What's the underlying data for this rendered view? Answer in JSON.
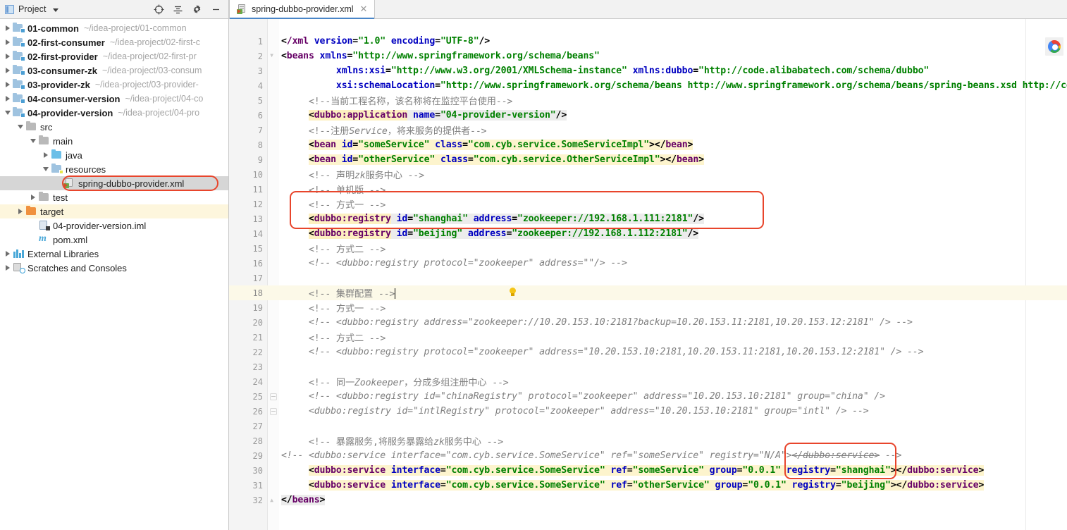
{
  "window": {
    "project_panel_title": "Project",
    "toolbar_icons": [
      "locate-icon",
      "collapse-all-icon",
      "settings-gear-icon",
      "minimize-icon"
    ]
  },
  "tab": {
    "label": "spring-dubbo-provider.xml",
    "close": "✕",
    "icon": "xml-file-icon"
  },
  "sidebar": {
    "items": [
      {
        "label": "01-common",
        "path": "~/idea-project/01-common",
        "indent": 0,
        "icon": "module-icon",
        "state": "collapsed"
      },
      {
        "label": "02-first-consumer",
        "path": "~/idea-project/02-first-c",
        "indent": 0,
        "icon": "module-icon",
        "state": "collapsed"
      },
      {
        "label": "02-first-provider",
        "path": "~/idea-project/02-first-pr",
        "indent": 0,
        "icon": "module-icon",
        "state": "collapsed"
      },
      {
        "label": "03-consumer-zk",
        "path": "~/idea-project/03-consum",
        "indent": 0,
        "icon": "module-icon",
        "state": "collapsed"
      },
      {
        "label": "03-provider-zk",
        "path": "~/idea-project/03-provider-",
        "indent": 0,
        "icon": "module-icon",
        "state": "collapsed"
      },
      {
        "label": "04-consumer-version",
        "path": "~/idea-project/04-co",
        "indent": 0,
        "icon": "module-icon",
        "state": "collapsed"
      },
      {
        "label": "04-provider-version",
        "path": "~/idea-project/04-pro",
        "indent": 0,
        "icon": "module-icon",
        "state": "expanded"
      },
      {
        "label": "src",
        "path": "",
        "indent": 1,
        "icon": "folder-icon",
        "state": "expanded",
        "plain": true
      },
      {
        "label": "main",
        "path": "",
        "indent": 2,
        "icon": "folder-icon",
        "state": "expanded",
        "plain": true
      },
      {
        "label": "java",
        "path": "",
        "indent": 3,
        "icon": "source-folder-icon",
        "state": "collapsed",
        "plain": true
      },
      {
        "label": "resources",
        "path": "",
        "indent": 3,
        "icon": "resources-folder-icon",
        "state": "expanded",
        "plain": true
      },
      {
        "label": "spring-dubbo-provider.xml",
        "path": "",
        "indent": 4,
        "icon": "xml-file-icon",
        "state": "none",
        "plain": true,
        "selected": true,
        "boxed": true
      },
      {
        "label": "test",
        "path": "",
        "indent": 2,
        "icon": "folder-icon",
        "state": "collapsed",
        "plain": true
      },
      {
        "label": "target",
        "path": "",
        "indent": 1,
        "icon": "target-folder-icon",
        "state": "collapsed",
        "plain": true,
        "highlight": true
      },
      {
        "label": "04-provider-version.iml",
        "path": "",
        "indent": 2,
        "icon": "iml-file-icon",
        "state": "none",
        "plain": true
      },
      {
        "label": "pom.xml",
        "path": "",
        "indent": 2,
        "icon": "maven-pom-icon",
        "state": "none",
        "plain": true
      },
      {
        "label": "External Libraries",
        "path": "",
        "indent": 0,
        "icon": "library-icon",
        "state": "collapsed",
        "plain": true
      },
      {
        "label": "Scratches and Consoles",
        "path": "",
        "indent": 0,
        "icon": "scratches-icon",
        "state": "collapsed",
        "plain": true
      }
    ]
  },
  "editor": {
    "current_line": 18,
    "total_lines": 32,
    "browser_icon": "chrome-icon",
    "bulb_icon": "intention-bulb-icon",
    "code": [
      {
        "n": 1,
        "html": "<span class='punct'>&lt;</span><span class='tagn'>/xml</span> <span class='attr'>version</span><span class='punct'>=</span><span class='val'>\"1.0\"</span> <span class='attr'>encoding</span><span class='punct'>=</span><span class='val'>\"UTF-8\"</span><span class='punct'>/&gt;</span>"
      },
      {
        "n": 2,
        "html": "<span class='punct'>&lt;</span><span class='tagn'>beans</span> <span class='attr'>xmlns</span><span class='punct'>=</span><span class='val'>\"http://www.springframework.org/schema/beans\"</span>"
      },
      {
        "n": 3,
        "html": "          <span class='attr'>xmlns:xsi</span><span class='punct'>=</span><span class='val'>\"http://www.w3.org/2001/XMLSchema-instance\"</span> <span class='attr'>xmlns:dubbo</span><span class='punct'>=</span><span class='val'>\"http://code.alibabatech.com/schema/dubbo\"</span>"
      },
      {
        "n": 4,
        "html": "          <span class='attr'>xsi:schemaLocation</span><span class='punct'>=</span><span class='val'>\"http://www.springframework.org/schema/beans http://www.springframework.org/schema/beans/spring-beans.xsd http://co</span>"
      },
      {
        "n": 5,
        "html": "     <span class='cmtz'>&lt;!--当前工程名称，该名称将在监控平台使用--&gt;</span>"
      },
      {
        "n": 6,
        "html": "     <span class='hl-tag punct'>&lt;</span><span class='hl-tag tagn'>dubbo:application</span><span class='hl-grey'> <span class='attr'>name</span><span class='punct'>=</span><span class='val'>\"04-provider-version\"</span><span class='punct'>/&gt;</span></span>"
      },
      {
        "n": 7,
        "html": "     <span class='cmtz'>&lt;!--注册<i>Service</i>，将来服务的提供者--&gt;</span>"
      },
      {
        "n": 8,
        "html": "     <span class='hl-yellow'><span class='punct'>&lt;</span><span class='tagn'>bean</span> <span class='attr'>id</span><span class='punct'>=</span><span class='val'>\"someService\"</span> <span class='attr'>class</span><span class='punct'>=</span><span class='val'>\"com.cyb.service.SomeServiceImpl\"</span><span class='punct'>&gt;&lt;/</span><span class='tagn'>bean</span><span class='punct'>&gt;</span></span>"
      },
      {
        "n": 9,
        "html": "     <span class='hl-yellow'><span class='punct'>&lt;</span><span class='tagn'>bean</span> <span class='attr'>id</span><span class='punct'>=</span><span class='val'>\"otherService\"</span> <span class='attr'>class</span><span class='punct'>=</span><span class='val'>\"com.cyb.service.OtherServiceImpl\"</span><span class='punct'>&gt;&lt;/</span><span class='tagn'>bean</span><span class='punct'>&gt;</span></span>"
      },
      {
        "n": 10,
        "html": "     <span class='cmtz'>&lt;!-- 声明<i>zk</i>服务中心 --&gt;</span>"
      },
      {
        "n": 11,
        "html": "     <span class='cmtz'>&lt;!-- 单机版 --&gt;</span>"
      },
      {
        "n": 12,
        "html": "     <span class='cmtz'>&lt;!-- 方式一 --&gt;</span>"
      },
      {
        "n": 13,
        "html": "     <span class='hl-tag punct'>&lt;</span><span class='hl-tag tagn'>dubbo:registry</span><span class='hl-grey'> <span class='attr'>id</span><span class='punct'>=</span><span class='val'>\"shanghai\"</span> <span class='attr'>address</span><span class='punct'>=</span><span class='val'>\"zookeeper://192.168.1.111:2181\"</span><span class='punct'>/&gt;</span></span>"
      },
      {
        "n": 14,
        "html": "     <span class='hl-tag punct'>&lt;</span><span class='hl-tag tagn'>dubbo:registry</span><span class='hl-grey'> <span class='attr'>id</span><span class='punct'>=</span><span class='val'>\"beijing\"</span> <span class='attr'>address</span><span class='punct'>=</span><span class='val'>\"zookeeper://192.168.1.112:2181\"</span><span class='punct'>/&gt;</span></span>"
      },
      {
        "n": 15,
        "html": "     <span class='cmtz'>&lt;!-- 方式二 --&gt;</span>"
      },
      {
        "n": 16,
        "html": "     <span class='cmt'>&lt;!-- &lt;dubbo:registry protocol=\"zookeeper\" address=\"\"/&gt; --&gt;</span>"
      },
      {
        "n": 17,
        "html": ""
      },
      {
        "n": 18,
        "html": "     <span class='cmtz'>&lt;!-- 集群配置 --&gt;</span><span class='caret'></span>"
      },
      {
        "n": 19,
        "html": "     <span class='cmtz'>&lt;!-- 方式一 --&gt;</span>"
      },
      {
        "n": 20,
        "html": "     <span class='cmt'>&lt;!-- &lt;dubbo:registry address=\"zookeeper://10.20.153.10:2181?backup=10.20.153.11:2181,10.20.153.12:2181\" /&gt; --&gt;</span>"
      },
      {
        "n": 21,
        "html": "     <span class='cmtz'>&lt;!-- 方式二 --&gt;</span>"
      },
      {
        "n": 22,
        "html": "     <span class='cmt'>&lt;!-- &lt;dubbo:registry protocol=\"zookeeper\" address=\"10.20.153.10:2181,10.20.153.11:2181,10.20.153.12:2181\" /&gt; --&gt;</span>"
      },
      {
        "n": 23,
        "html": ""
      },
      {
        "n": 24,
        "html": "     <span class='cmtz'>&lt;!-- 同一<i>Zookeeper</i>，分成多组注册中心 --&gt;</span>"
      },
      {
        "n": 25,
        "html": "     <span class='cmt'>&lt;!-- &lt;dubbo:registry id=\"chinaRegistry\" protocol=\"zookeeper\" address=\"10.20.153.10:2181\" group=\"china\" /&gt;</span>"
      },
      {
        "n": 26,
        "html": "     <span class='cmt'>&lt;dubbo:registry id=\"intlRegistry\" protocol=\"zookeeper\" address=\"10.20.153.10:2181\" group=\"intl\" /&gt; --&gt;</span>"
      },
      {
        "n": 27,
        "html": ""
      },
      {
        "n": 28,
        "html": "     <span class='cmtz'>&lt;!-- 暴露服务,将服务暴露给<i>zk</i>服务中心 --&gt;</span>"
      },
      {
        "n": 29,
        "html": "<span class='cmt'>&lt;!-- &lt;dubbo:service interface=\"com.cyb.service.SomeService\" ref=\"someService\" registry=\"N/A\"&gt;<span class='strike'>&lt;/dubbo:service&gt;</span> --&gt;</span>"
      },
      {
        "n": 30,
        "html": "     <span class='hl-yellow'><span class='punct'>&lt;</span><span class='tagn'>dubbo:service</span> <span class='attr'>interface</span><span class='punct'>=</span><span class='val'>\"com.cyb.service.SomeService\"</span> <span class='attr'>ref</span><span class='punct'>=</span><span class='val'>\"someService\"</span> <span class='attr'>group</span><span class='punct'>=</span><span class='val'>\"0.0.1\"</span> <span class='attr'>registry</span><span class='punct'>=</span><span class='val'>\"shanghai\"</span><span class='punct'>&gt;&lt;/</span><span class='tagn'>dubbo:service</span><span class='punct'>&gt;</span></span>"
      },
      {
        "n": 31,
        "html": "     <span class='hl-yellow'><span class='punct'>&lt;</span><span class='tagn'>dubbo:service</span> <span class='attr'>interface</span><span class='punct'>=</span><span class='val'>\"com.cyb.service.SomeService\"</span> <span class='attr'>ref</span><span class='punct'>=</span><span class='val'>\"otherService\"</span> <span class='attr'>group</span><span class='punct'>=</span><span class='val'>\"0.0.1\"</span> <span class='attr'>registry</span><span class='punct'>=</span><span class='val'>\"beijing\"</span><span class='punct'>&gt;&lt;/</span><span class='tagn'>dubbo:service</span><span class='punct'>&gt;</span></span>"
      },
      {
        "n": 32,
        "html": "<span class='hl-grey'><span class='punct'>&lt;/</span><span class='tagn'>beans</span><span class='punct'>&gt;</span></span>"
      }
    ],
    "annotations": {
      "color": "#e8452c",
      "boxes": [
        {
          "name": "registry-declaration-box",
          "lines": "13-14"
        },
        {
          "name": "service-registry-attribute-box",
          "lines": "30-31"
        },
        {
          "name": "sidebar-file-box",
          "target": "spring-dubbo-provider.xml"
        }
      ]
    }
  }
}
